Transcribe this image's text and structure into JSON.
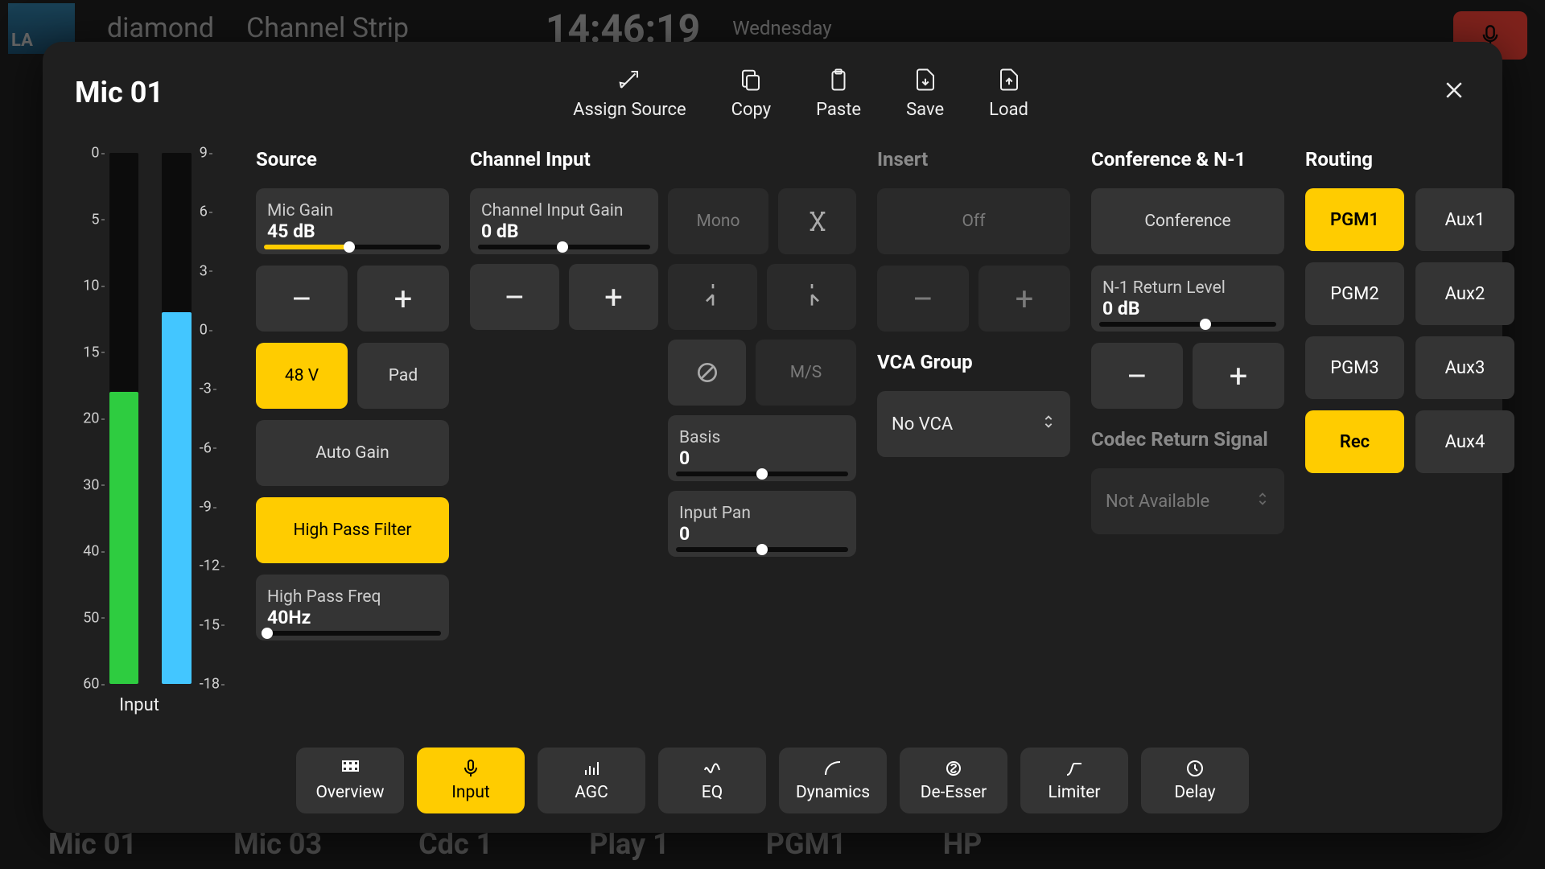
{
  "backdrop": {
    "brand": "LA",
    "left1": "diamond",
    "left2": "Channel Strip",
    "clock": "14:46:19",
    "day": "Wednesday",
    "channels": [
      "Mic 01",
      "Mic 03",
      "Cdc 1",
      "Play 1",
      "PGM1",
      "HP"
    ]
  },
  "modal": {
    "title": "Mic 01",
    "actions": {
      "assign": "Assign Source",
      "copy": "Copy",
      "paste": "Paste",
      "save": "Save",
      "load": "Load"
    }
  },
  "meters": {
    "label": "Input",
    "left_scale": [
      "0",
      "5",
      "10",
      "15",
      "20",
      "30",
      "40",
      "50",
      "60"
    ],
    "right_scale": [
      "9",
      "6",
      "3",
      "0",
      "-3",
      "-6",
      "-9",
      "-12",
      "-15",
      "-18"
    ],
    "left_fill_pct": 55,
    "left_color": "#2ecc40",
    "right_fill_pct": 70,
    "right_color": "#43c6ff"
  },
  "source": {
    "title": "Source",
    "mic_gain": {
      "label": "Mic Gain",
      "value": "45 dB",
      "pct": 48,
      "color": "#ffcc00"
    },
    "v48": "48 V",
    "pad": "Pad",
    "auto": "Auto Gain",
    "hpf": "High Pass Filter",
    "hpfreq": {
      "label": "High Pass Freq",
      "value": "40Hz",
      "pct": 2
    }
  },
  "chinput": {
    "title": "Channel Input",
    "gain": {
      "label": "Channel Input Gain",
      "value": "0 dB",
      "pct": 49
    },
    "mono": "Mono",
    "ms": "M/S",
    "basis": {
      "label": "Basis",
      "value": "0",
      "pct": 50
    },
    "pan": {
      "label": "Input Pan",
      "value": "0",
      "pct": 50
    }
  },
  "insert": {
    "title": "Insert",
    "off": "Off"
  },
  "vca": {
    "title": "VCA Group",
    "value": "No VCA"
  },
  "conf": {
    "title": "Conference & N-1",
    "conference": "Conference",
    "n1": {
      "label": "N-1 Return Level",
      "value": "0 dB",
      "pct": 60
    },
    "codec_title": "Codec Return Signal",
    "codec_value": "Not Available"
  },
  "routing": {
    "title": "Routing",
    "items": [
      {
        "label": "PGM1",
        "on": true
      },
      {
        "label": "Aux1",
        "on": false
      },
      {
        "label": "PGM2",
        "on": false
      },
      {
        "label": "Aux2",
        "on": false
      },
      {
        "label": "PGM3",
        "on": false
      },
      {
        "label": "Aux3",
        "on": false
      },
      {
        "label": "Rec",
        "on": true
      },
      {
        "label": "Aux4",
        "on": false
      }
    ]
  },
  "tabs": [
    {
      "label": "Overview",
      "icon": "grid"
    },
    {
      "label": "Input",
      "icon": "mic",
      "active": true
    },
    {
      "label": "AGC",
      "icon": "bars"
    },
    {
      "label": "EQ",
      "icon": "wave"
    },
    {
      "label": "Dynamics",
      "icon": "curve"
    },
    {
      "label": "De-Esser",
      "icon": "deess"
    },
    {
      "label": "Limiter",
      "icon": "limit"
    },
    {
      "label": "Delay",
      "icon": "clock"
    }
  ]
}
